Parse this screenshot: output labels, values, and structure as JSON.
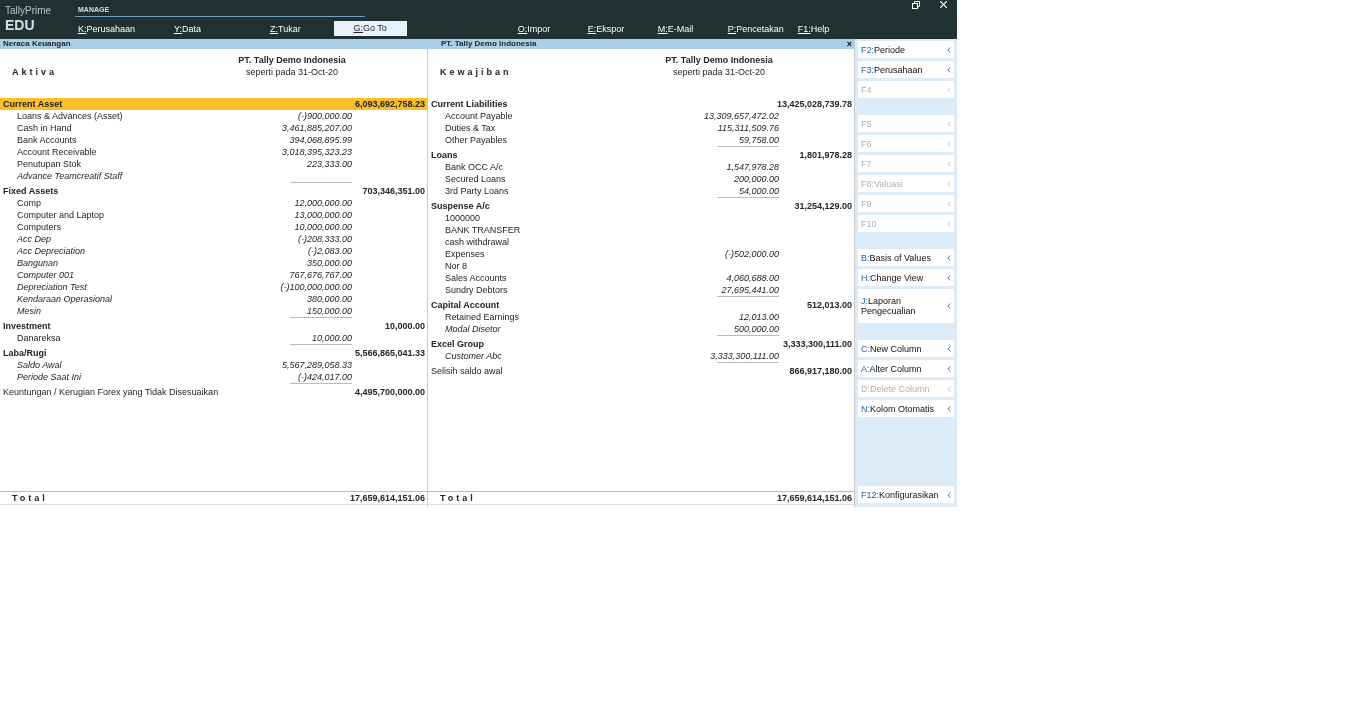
{
  "app": {
    "brand": "TallyPrime",
    "edition": "EDU",
    "menu_title": "MANAGE"
  },
  "menu": [
    {
      "key": "K:",
      "label": "Perusahaan",
      "kind": "item"
    },
    {
      "key": "Y:",
      "label": "Data",
      "kind": "item"
    },
    {
      "key": "Z:",
      "label": "Tukar",
      "kind": "item"
    },
    {
      "key": "G:",
      "label": "Go To",
      "kind": "button"
    },
    {
      "key": "O:",
      "label": "Impor",
      "kind": "item"
    },
    {
      "key": "E:",
      "label": "Ekspor",
      "kind": "item"
    },
    {
      "key": "M:",
      "label": "E-Mail",
      "kind": "item"
    },
    {
      "key": "P:",
      "label": "Pencetakan",
      "kind": "item"
    },
    {
      "key": "F1:",
      "label": "Help",
      "kind": "item"
    }
  ],
  "report": {
    "title": "Neraca Keuangan",
    "company": "PT. Tally Demo Indonesia",
    "close": "×"
  },
  "panes": [
    {
      "heading": "Aktiva",
      "company": "PT. Tally Demo Indonesia",
      "date": "seperti pada 31-Oct-20",
      "total_label": "Total",
      "total": "17,659,614,151.06",
      "groups": [
        {
          "kind": "group",
          "label": "Current Asset",
          "amount": "6,093,692,758.23",
          "selected": true,
          "children": [
            {
              "label": "Loans & Advances (Asset)",
              "amount": "(-)900,000.00",
              "italic": false
            },
            {
              "label": "Cash in Hand",
              "amount": "3,461,885,207.00",
              "italic": false
            },
            {
              "label": "Bank Accounts",
              "amount": "394,068,895.99",
              "italic": false
            },
            {
              "label": "Account Receivable",
              "amount": "3,018,395,323.23",
              "italic": false
            },
            {
              "label": "Penutupan Stok",
              "amount": "223,333.00",
              "italic": false
            },
            {
              "label": "Advance Teamcreatif Staff",
              "italic": true
            }
          ]
        },
        {
          "kind": "group",
          "label": "Fixed Assets",
          "amount": "703,346,351.00",
          "selected": false,
          "children": [
            {
              "label": "Comp",
              "amount": "12,000,000.00",
              "italic": false
            },
            {
              "label": "Computer and Laptop",
              "amount": "13,000,000.00",
              "italic": false
            },
            {
              "label": "Computers",
              "amount": "10,000,000.00",
              "italic": false
            },
            {
              "label": "Acc Dep",
              "amount": "(-)208,333.00",
              "italic": true
            },
            {
              "label": "Acc Depreciation",
              "amount": "(-)2,083.00",
              "italic": true
            },
            {
              "label": "Bangunan",
              "amount": "350,000.00",
              "italic": true
            },
            {
              "label": "Computer 001",
              "amount": "767,676,767.00",
              "italic": true
            },
            {
              "label": "Depreciation Test",
              "amount": "(-)100,000,000.00",
              "italic": true
            },
            {
              "label": "Kendaraan Operasional",
              "amount": "380,000.00",
              "italic": true
            },
            {
              "label": "Mesin",
              "amount": "150,000.00",
              "italic": true
            }
          ]
        },
        {
          "kind": "group",
          "label": "Investment",
          "amount": "10,000.00",
          "selected": false,
          "children": [
            {
              "label": "Danareksa",
              "amount": "10,000.00",
              "italic": false
            }
          ]
        },
        {
          "kind": "group",
          "label": "Laba/Rugi",
          "amount": "5,566,865,041.33",
          "selected": false,
          "children": [
            {
              "label": "Saldo Awal",
              "amount": "5,567,289,058.33",
              "italic": true
            },
            {
              "label": "Periode Saat Ini",
              "amount": "(-)424,017.00",
              "italic": true
            }
          ]
        },
        {
          "kind": "ledger",
          "label": "Keuntungan / Kerugian Forex yang Tidak Disesuaikan",
          "amount": "4,495,700,000.00",
          "selected": false
        }
      ]
    },
    {
      "heading": "Kewajiban",
      "company": "PT. Tally Demo Indonesia",
      "date": "seperti pada 31-Oct-20",
      "total_label": "Total",
      "total": "17,659,614,151.06",
      "groups": [
        {
          "kind": "group",
          "label": "Current Liabilities",
          "amount": "13,425,028,739.78",
          "selected": false,
          "children": [
            {
              "label": "Account Payable",
              "amount": "13,309,657,472.02",
              "italic": false
            },
            {
              "label": "Duties & Tax",
              "amount": "115,311,509.76",
              "italic": false
            },
            {
              "label": "Other Payables",
              "amount": "59,758.00",
              "italic": false
            }
          ]
        },
        {
          "kind": "group",
          "label": "Loans",
          "amount": "1,801,978.28",
          "selected": false,
          "children": [
            {
              "label": "Bank OCC A/c",
              "amount": "1,547,978.28",
              "italic": false
            },
            {
              "label": "Secured Loans",
              "amount": "200,000.00",
              "italic": false
            },
            {
              "label": "3rd Party Loans",
              "amount": "54,000.00",
              "italic": false
            }
          ]
        },
        {
          "kind": "group",
          "label": "Suspense A/c",
          "amount": "31,254,129.00",
          "selected": false,
          "children": [
            {
              "label": "1000000",
              "italic": false
            },
            {
              "label": "BANK TRANSFER",
              "italic": false
            },
            {
              "label": "cash withdrawal",
              "italic": false
            },
            {
              "label": "Expenses",
              "amount": "(-)502,000.00",
              "italic": false
            },
            {
              "label": "Nor 8",
              "italic": false
            },
            {
              "label": "Sales Accounts",
              "amount": "4,060,688.00",
              "italic": false
            },
            {
              "label": "Sundry Debtors",
              "amount": "27,695,441.00",
              "italic": false
            }
          ]
        },
        {
          "kind": "group",
          "label": "Capital Account",
          "amount": "512,013.00",
          "selected": false,
          "children": [
            {
              "label": "Retained Earnings",
              "amount": "12,013.00",
              "italic": false
            },
            {
              "label": "Modal Disetor",
              "amount": "500,000.00",
              "italic": true
            }
          ]
        },
        {
          "kind": "group",
          "label": "Excel Group",
          "amount": "3,333,300,111.00",
          "selected": false,
          "children": [
            {
              "label": "Customer Abc",
              "amount": "3,333,300,111.00",
              "italic": true
            }
          ]
        },
        {
          "kind": "ledger",
          "label": "Selisih saldo awal",
          "amount": "866,917,180.00",
          "selected": false
        }
      ]
    }
  ],
  "sidebar": {
    "sections": [
      [
        {
          "key": "F2:",
          "label": "Periode",
          "disabled": false
        },
        {
          "key": "F3:",
          "label": "Perusahaan",
          "disabled": false
        },
        {
          "key": "F4",
          "disabled": true
        }
      ],
      [
        {
          "key": "F5",
          "disabled": true
        },
        {
          "key": "F6",
          "disabled": true
        },
        {
          "key": "F7",
          "disabled": true
        },
        {
          "key": "F8:",
          "label": "Valuasi",
          "disabled": true
        },
        {
          "key": "F9",
          "disabled": true
        },
        {
          "key": "F10",
          "disabled": true
        }
      ],
      [
        {
          "key": "B:",
          "label": "Basis of Values",
          "disabled": false
        },
        {
          "key": "H:",
          "label": "Change View",
          "disabled": false
        },
        {
          "key": "J:",
          "label": "Laporan Pengecualian",
          "disabled": false
        }
      ],
      [
        {
          "key": "C:",
          "label": "New Column",
          "disabled": false
        },
        {
          "key": "A:",
          "label": "Alter Column",
          "disabled": false
        },
        {
          "key": "D:",
          "label": "Delete Column",
          "disabled": true
        },
        {
          "key": "N:",
          "label": "Kolom Otomatis",
          "disabled": false
        }
      ]
    ],
    "footer": {
      "key": "F12:",
      "label": "Konfigurasikan",
      "disabled": false
    }
  }
}
